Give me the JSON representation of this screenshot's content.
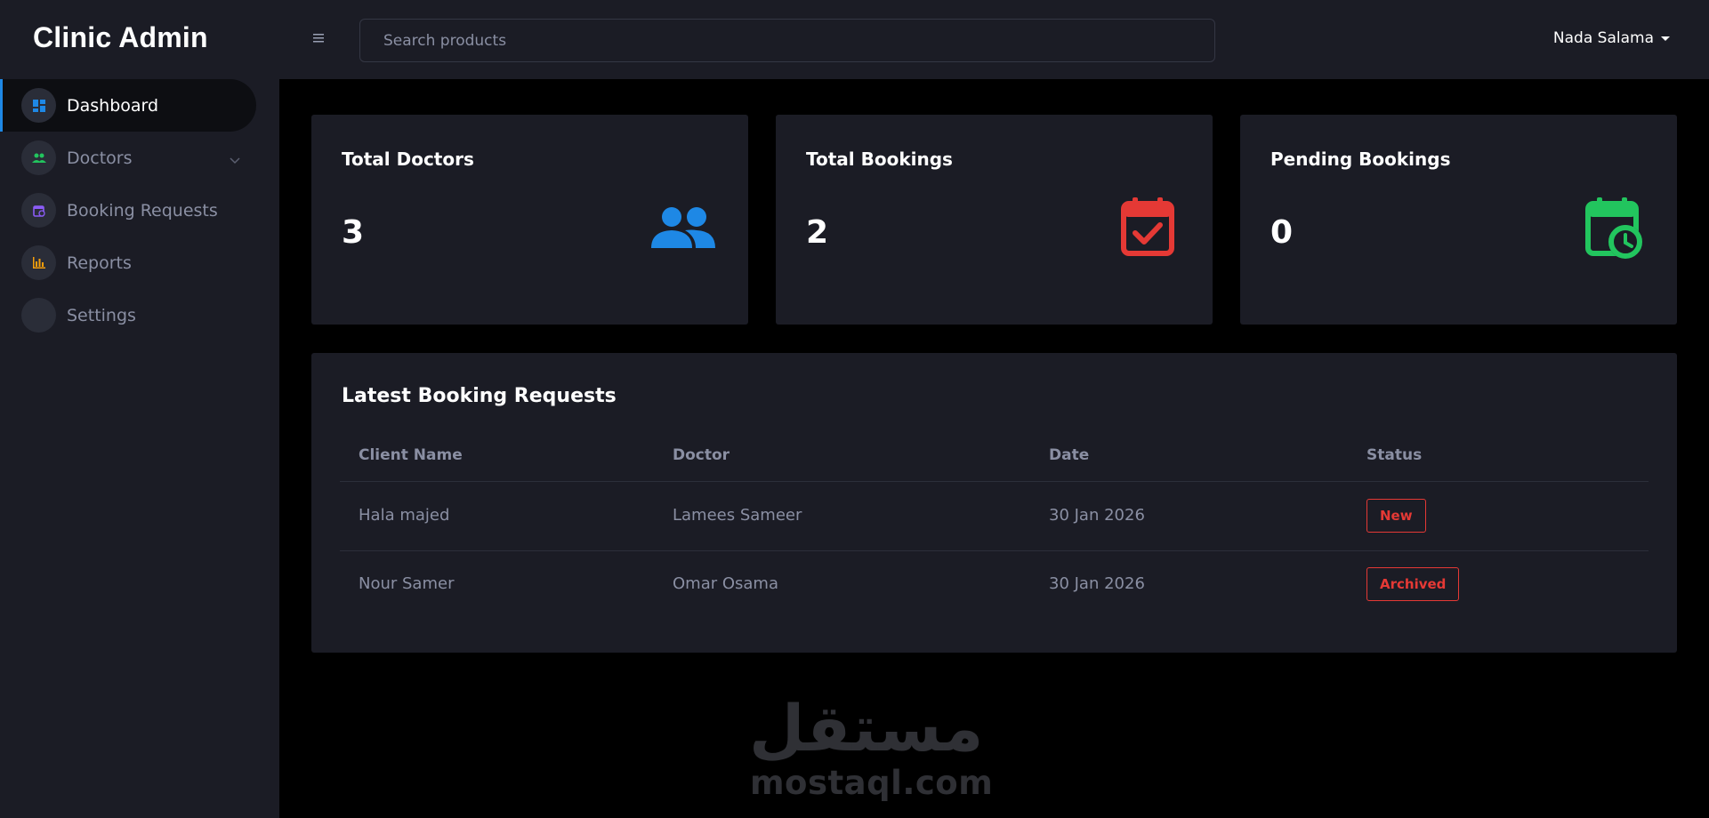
{
  "app": {
    "title": "Clinic Admin"
  },
  "sidebar": {
    "items": [
      {
        "label": "Dashboard",
        "icon": "dashboard-icon",
        "icon_color": "#1e88e5",
        "active": true
      },
      {
        "label": "Doctors",
        "icon": "users-icon",
        "icon_color": "#22c55e",
        "has_submenu": true
      },
      {
        "label": "Booking Requests",
        "icon": "calendar-clock-icon",
        "icon_color": "#8b5cf6"
      },
      {
        "label": "Reports",
        "icon": "bar-chart-icon",
        "icon_color": "#f59e0b"
      },
      {
        "label": "Settings",
        "icon": "settings-icon"
      }
    ]
  },
  "header": {
    "search_placeholder": "Search products",
    "user_name": "Nada Salama"
  },
  "stats": [
    {
      "title": "Total Doctors",
      "value": "3",
      "icon": "users-icon",
      "color": "#1e88e5"
    },
    {
      "title": "Total Bookings",
      "value": "2",
      "icon": "calendar-check-icon",
      "color": "#e53935"
    },
    {
      "title": "Pending Bookings",
      "value": "0",
      "icon": "calendar-clock-icon",
      "color": "#22c55e"
    }
  ],
  "bookings": {
    "title": "Latest Booking Requests",
    "columns": [
      "Client Name",
      "Doctor",
      "Date",
      "Status"
    ],
    "rows": [
      {
        "client": "Hala majed",
        "doctor": "Lamees Sameer",
        "date": "30 Jan 2026",
        "status": "New"
      },
      {
        "client": "Nour Samer",
        "doctor": "Omar Osama",
        "date": "30 Jan 2026",
        "status": "Archived"
      }
    ],
    "status_color": "#e53935"
  },
  "watermark": {
    "arabic": "مستقل",
    "text": "mostaql.com"
  },
  "colors": {
    "background": "#000000",
    "surface": "#1b1c25",
    "accent": "#1e88e5",
    "muted_text": "#8a8fa3"
  }
}
